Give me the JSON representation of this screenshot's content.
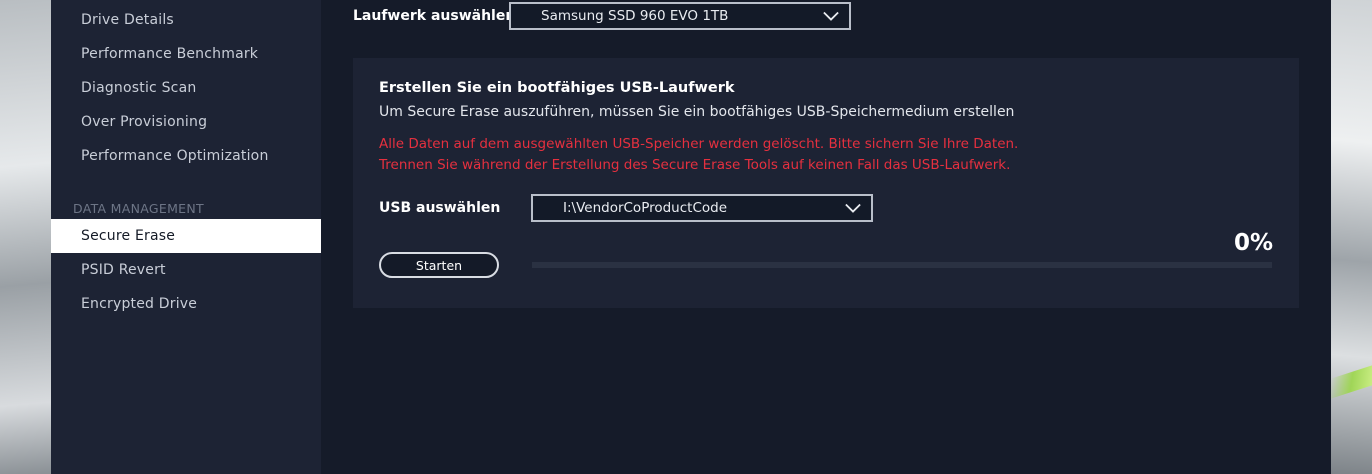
{
  "sidebar": {
    "items_top": [
      {
        "label": "Drive Details"
      },
      {
        "label": "Performance Benchmark"
      },
      {
        "label": "Diagnostic Scan"
      },
      {
        "label": "Over Provisioning"
      },
      {
        "label": "Performance Optimization"
      }
    ],
    "section_label": "DATA MANAGEMENT",
    "items_data": [
      {
        "label": "Secure Erase",
        "active": true
      },
      {
        "label": "PSID Revert"
      },
      {
        "label": "Encrypted Drive"
      }
    ]
  },
  "drive": {
    "label": "Laufwerk auswählen",
    "selected": "Samsung SSD 960 EVO 1TB"
  },
  "card": {
    "title": "Erstellen Sie ein bootfähiges USB-Laufwerk",
    "subtitle": "Um Secure Erase auszuführen, müssen Sie ein bootfähiges USB-Speichermedium erstellen",
    "warning_1": "Alle Daten auf dem ausgewählten USB-Speicher werden gelöscht. Bitte sichern Sie Ihre Daten.",
    "warning_2": "Trennen Sie während der Erstellung des Secure Erase Tools auf keinen Fall das USB-Laufwerk.",
    "usb_label": "USB auswählen",
    "usb_selected": "I:\\VendorCoProductCode",
    "start_label": "Starten",
    "progress_text": "0%",
    "progress_value": 0
  },
  "colors": {
    "app_bg": "#151b29",
    "sidebar_bg": "#1d2334",
    "card_bg": "#1d2334",
    "warning": "#e5303f",
    "active_bg": "#ffffff"
  },
  "icons": {
    "dropdown": "chevron-down-icon"
  }
}
